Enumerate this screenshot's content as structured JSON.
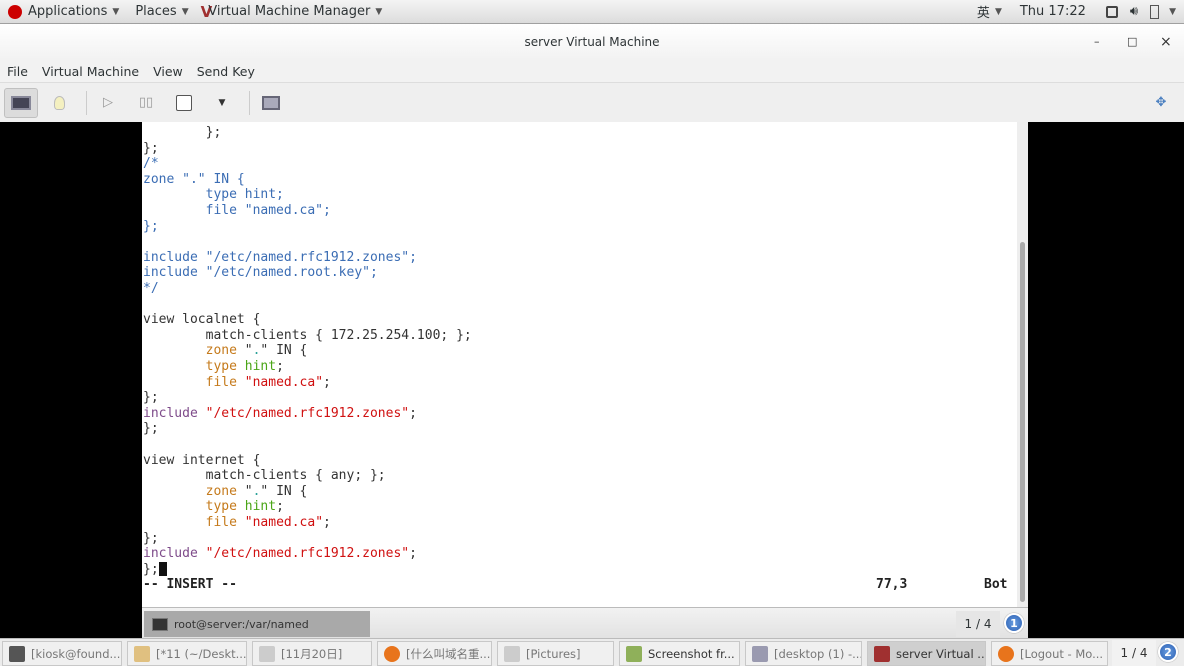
{
  "topbar": {
    "applications": "Applications",
    "places": "Places",
    "app_menu": "Virtual Machine Manager",
    "input_method": "英",
    "clock": "Thu 17:22"
  },
  "window": {
    "title": "server Virtual Machine",
    "minimize": "–",
    "maximize": "□",
    "close": "×"
  },
  "menu": [
    "File",
    "Virtual Machine",
    "View",
    "Send Key"
  ],
  "toolbar": {
    "icons": [
      "console-icon",
      "details-lightbulb-icon",
      "run-icon",
      "pause-icon",
      "shutdown-icon",
      "dropdown-icon",
      "snapshot-icon",
      "fullscreen-icon"
    ]
  },
  "editor": {
    "lines": [
      [
        [
          "        };",
          "n"
        ]
      ],
      [
        [
          "};",
          "n"
        ]
      ],
      [
        [
          "/*",
          "c"
        ]
      ],
      [
        [
          "zone \".\" IN {",
          "c"
        ]
      ],
      [
        [
          "        type hint;",
          "c"
        ]
      ],
      [
        [
          "        file \"named.ca\";",
          "c"
        ]
      ],
      [
        [
          "};",
          "c"
        ]
      ],
      [
        [
          "",
          ""
        ]
      ],
      [
        [
          "include \"/etc/named.rfc1912.zones\";",
          "c"
        ]
      ],
      [
        [
          "include \"/etc/named.root.key\";",
          "c"
        ]
      ],
      [
        [
          "*/",
          "c"
        ]
      ],
      [
        [
          "",
          ""
        ]
      ],
      [
        [
          "view localnet {",
          "n"
        ]
      ],
      [
        [
          "        match-clients { 172.25.254.100; };",
          "n"
        ]
      ],
      [
        [
          "        ",
          "n"
        ],
        [
          "zone",
          "k"
        ],
        [
          " \"",
          "n"
        ],
        [
          ".",
          "t"
        ],
        [
          "\" IN {",
          "n"
        ]
      ],
      [
        [
          "        ",
          "n"
        ],
        [
          "type",
          "k"
        ],
        [
          " ",
          "n"
        ],
        [
          "hint",
          "g"
        ],
        [
          ";",
          "n"
        ]
      ],
      [
        [
          "        ",
          "n"
        ],
        [
          "file",
          "k"
        ],
        [
          " ",
          "n"
        ],
        [
          "\"named.ca\"",
          "s"
        ],
        [
          ";",
          "n"
        ]
      ],
      [
        [
          "};",
          "n"
        ]
      ],
      [
        [
          "include",
          "p"
        ],
        [
          " ",
          "n"
        ],
        [
          "\"/etc/named.rfc1912.zones\"",
          "s"
        ],
        [
          ";",
          "n"
        ]
      ],
      [
        [
          "};",
          "n"
        ]
      ],
      [
        [
          "",
          ""
        ]
      ],
      [
        [
          "view internet {",
          "n"
        ]
      ],
      [
        [
          "        match-clients { any; };",
          "n"
        ]
      ],
      [
        [
          "        ",
          "n"
        ],
        [
          "zone",
          "k"
        ],
        [
          " \"",
          "n"
        ],
        [
          ".",
          "t"
        ],
        [
          "\" IN {",
          "n"
        ]
      ],
      [
        [
          "        ",
          "n"
        ],
        [
          "type",
          "k"
        ],
        [
          " ",
          "n"
        ],
        [
          "hint",
          "g"
        ],
        [
          ";",
          "n"
        ]
      ],
      [
        [
          "        ",
          "n"
        ],
        [
          "file",
          "k"
        ],
        [
          " ",
          "n"
        ],
        [
          "\"named.ca\"",
          "s"
        ],
        [
          ";",
          "n"
        ]
      ],
      [
        [
          "};",
          "n"
        ]
      ],
      [
        [
          "include",
          "p"
        ],
        [
          " ",
          "n"
        ],
        [
          "\"/etc/named.rfc1912.zones\"",
          "s"
        ],
        [
          ";",
          "n"
        ]
      ],
      [
        [
          "};",
          "n"
        ]
      ]
    ],
    "mode": "-- INSERT --",
    "position": "77,3",
    "scroll": "Bot"
  },
  "vm_panel": {
    "terminal_tab": "root@server:/var/named",
    "workspace": "1 / 4",
    "workspace_badge": "1"
  },
  "taskbar": {
    "items": [
      {
        "label": "[kiosk@found...",
        "icon": "terminal-icon",
        "color": "#555555"
      },
      {
        "label": "[*11 (~/Deskt...",
        "icon": "text-editor-icon",
        "color": "#e0c080"
      },
      {
        "label": "[11月20日]",
        "icon": "file-manager-icon",
        "color": "#cccccc"
      },
      {
        "label": "[什么叫域名重...",
        "icon": "firefox-icon",
        "color": "#e8741c"
      },
      {
        "label": "[Pictures]",
        "icon": "file-manager-icon",
        "color": "#cccccc"
      },
      {
        "label": "Screenshot fr...",
        "icon": "screenshot-icon",
        "color": "#8fb05a"
      },
      {
        "label": "[desktop (1) -...",
        "icon": "monitor-icon",
        "color": "#9a9ab0"
      },
      {
        "label": "server Virtual ...",
        "icon": "virt-manager-icon",
        "color": "#a03030"
      },
      {
        "label": "[Logout - Mo...",
        "icon": "firefox-icon",
        "color": "#e8741c"
      }
    ],
    "workspace": "1 / 4",
    "workspace_badge": "2"
  }
}
